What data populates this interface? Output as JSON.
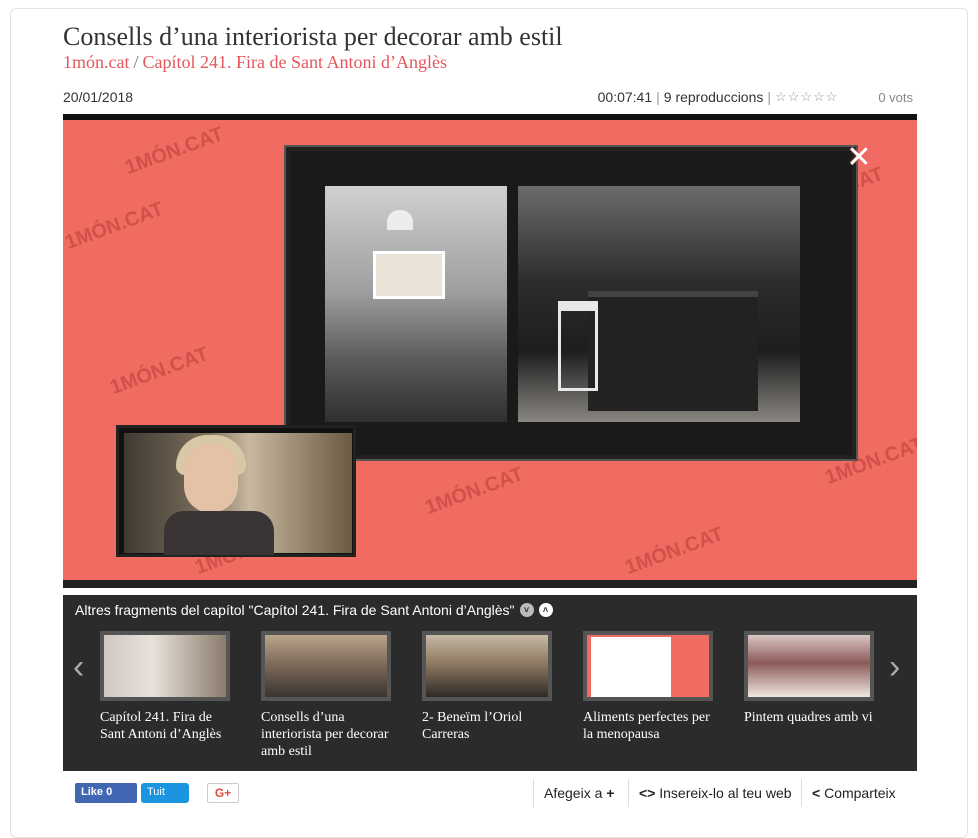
{
  "header": {
    "title": "Consells d’una interiorista per decorar amb estil",
    "source": "1món.cat",
    "separator": "/",
    "episode": "Capítol 241. Fira de Sant Antoni d’Anglès",
    "date": "20/01/2018",
    "duration": "00:07:41",
    "plays": "9 reproduccions",
    "stars": "☆☆☆☆☆",
    "votes": "0 vots"
  },
  "player": {
    "close_glyph": "✕",
    "watermark": "1MÓN.CAT"
  },
  "related": {
    "heading": "Altres fragments del capítol \"Capítol 241. Fira de Sant Antoni d’Anglès\"",
    "collapse_glyph": "˅",
    "expand_glyph": "˄",
    "prev_glyph": "‹",
    "next_glyph": "›",
    "items": [
      {
        "caption": "Capítol 241. Fira de Sant Antoni d’Anglès"
      },
      {
        "caption": "Consells d’una interiorista per decorar amb estil"
      },
      {
        "caption": "2- Beneïm l’Oriol Carreras"
      },
      {
        "caption": "Aliments perfectes per la menopausa"
      },
      {
        "caption": "Pintem quadres amb vi"
      }
    ]
  },
  "social": {
    "like_label": "Like 0",
    "tuit_label": "Tuit",
    "gplus_label": "G+"
  },
  "actions": {
    "add_label": "Afegeix a",
    "add_icon": "+",
    "embed_icon": "<>",
    "embed_label": "Insereix-lo al teu web",
    "share_icon": "<",
    "share_label": "Comparteix"
  },
  "colors": {
    "accent": "#e5565a",
    "player_bg": "#f06b62",
    "strip_bg": "#2b2b2b"
  }
}
